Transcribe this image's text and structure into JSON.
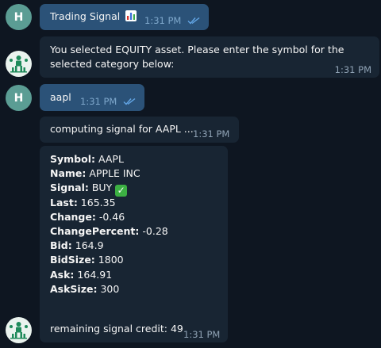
{
  "messages": {
    "m1": {
      "avatar_letter": "H",
      "text": "Trading Signal",
      "emoji": "bar-chart",
      "time": "1:31 PM",
      "read": true
    },
    "m2": {
      "text": "You selected EQUITY asset. Please enter the symbol for the selected category below:",
      "time": "1:31 PM"
    },
    "m3": {
      "avatar_letter": "H",
      "text": "aapl",
      "time": "1:31 PM",
      "read": true
    },
    "m4": {
      "text": "computing signal for AAPL ...",
      "time": "1:31 PM"
    },
    "m5": {
      "fields": [
        {
          "label": "Symbol:",
          "value": " AAPL"
        },
        {
          "label": "Name:",
          "value": " APPLE INC"
        },
        {
          "label": "Signal:",
          "value": " BUY "
        },
        {
          "label": "Last:",
          "value": " 165.35"
        },
        {
          "label": "Change:",
          "value": " -0.46"
        },
        {
          "label": "ChangePercent:",
          "value": " -0.28"
        },
        {
          "label": "Bid:",
          "value": " 164.9"
        },
        {
          "label": "BidSize:",
          "value": " 1800"
        },
        {
          "label": "Ask:",
          "value": " 164.91"
        },
        {
          "label": "AskSize:",
          "value": " 300"
        }
      ],
      "footer": "remaining signal credit: 49",
      "time": "1:31 PM"
    }
  },
  "colors": {
    "background": "#0e1621",
    "outgoing_bubble": "#2b5278",
    "incoming_bubble": "#182533",
    "user_avatar": "#5b9d94",
    "check_emoji": "#3cb043"
  }
}
